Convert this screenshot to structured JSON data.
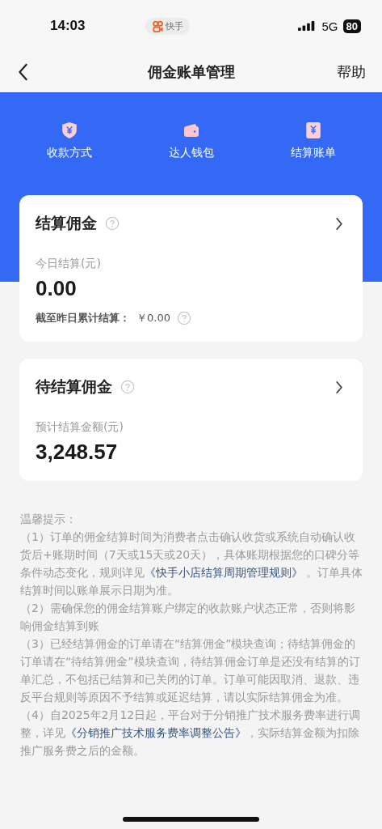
{
  "status_bar": {
    "time": "14:03",
    "app_badge": "快手",
    "network": "5G",
    "battery": "80"
  },
  "nav": {
    "title": "佣金账单管理",
    "action": "帮助"
  },
  "shortcuts": [
    {
      "label": "收款方式",
      "kind": "shield"
    },
    {
      "label": "达人钱包",
      "kind": "wallet"
    },
    {
      "label": "结算账单",
      "kind": "bill"
    }
  ],
  "cards": [
    {
      "title": "结算佣金",
      "label": "今日结算(元)",
      "amount": "0.00",
      "footer": "截至昨日累计结算：",
      "footer_value": "￥0.00"
    },
    {
      "title": "待结算佣金",
      "label": "预计结算金额(元)",
      "amount": "3,248.57"
    }
  ],
  "notes": {
    "heading": "温馨提示：",
    "items": [
      [
        {
          "text": "（1）订单的佣金结算时间为消费者点击确认收货或系统自动确认收货后+账期时间（7天或15天或20天），具体账期根据您的口碑分等条件动态变化，规则详见"
        },
        {
          "link": "《快手小店结算周期管理规则》"
        },
        {
          "text": " 。订单具体结算时间以账单展示日期为准。"
        }
      ],
      [
        {
          "text": "（2）需确保您的佣金结算账户绑定的收款账户状态正常，否则将影响佣金结算到账"
        }
      ],
      [
        {
          "text": "（3）已经结算佣金的订单请在“结算佣金”模块查询；待结算佣金的订单请在“待结算佣金”模块查询，待结算佣金订单是还没有结算的订单汇总，不包括已结算和已关闭的订单。订单可能因取消、退款、违反平台规则等原因不予结算或延迟结算，请以实际结算佣金为准。"
        }
      ],
      [
        {
          "text": "（4）自2025年2月12日起，平台对于分销推广技术服务费率进行调整，详见"
        },
        {
          "link": "《分销推广技术服务费率调整公告》"
        },
        {
          "text": "，实际结算金额为扣除推广服务费之后的金额。"
        }
      ]
    ]
  }
}
